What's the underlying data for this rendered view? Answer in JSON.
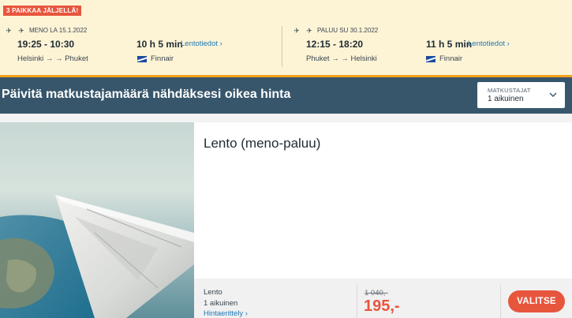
{
  "badge": {
    "seats_left": "3 PAIKKAA JÄLJELLÄ!"
  },
  "outbound": {
    "direction_icon": "plane-departure-icon",
    "landing_icon": "plane-landing-icon",
    "date_label": "MENO LA 15.1.2022",
    "times": "19:25 - 10:30",
    "route": "Helsinki → → Phuket",
    "duration": "10 h 5 min",
    "details_link": "Lentotiedot ›",
    "airline": "Finnair"
  },
  "return": {
    "direction_icon": "plane-departure-icon",
    "landing_icon": "plane-landing-icon",
    "date_label": "PALUU SU 30.1.2022",
    "times": "12:15 - 18:20",
    "route": "Phuket → → Helsinki",
    "duration": "11 h 5 min",
    "details_link": "Lentotiedot ›",
    "airline": "Finnair"
  },
  "passenger_bar": {
    "title": "Päivitä matkustajamäärä nähdäksesi oikea hinta",
    "select_label": "MATKUSTAJAT",
    "select_value": "1 aikuinen"
  },
  "card": {
    "title": "Lento (meno-paluu)",
    "price_label": "Lento",
    "price_passengers": "1 aikuinen",
    "breakdown_link": "Hintaerittely ›",
    "old_price": "1 040,-",
    "price": "195,-",
    "select_button": "VALITSE"
  },
  "colors": {
    "summary_bg": "#fdf4d6",
    "accent_orange": "#f4a11d",
    "pax_bar": "#37566b",
    "price_red": "#e8553d",
    "link_blue": "#1e78b4",
    "finnair_blue": "#1d4aa0"
  }
}
